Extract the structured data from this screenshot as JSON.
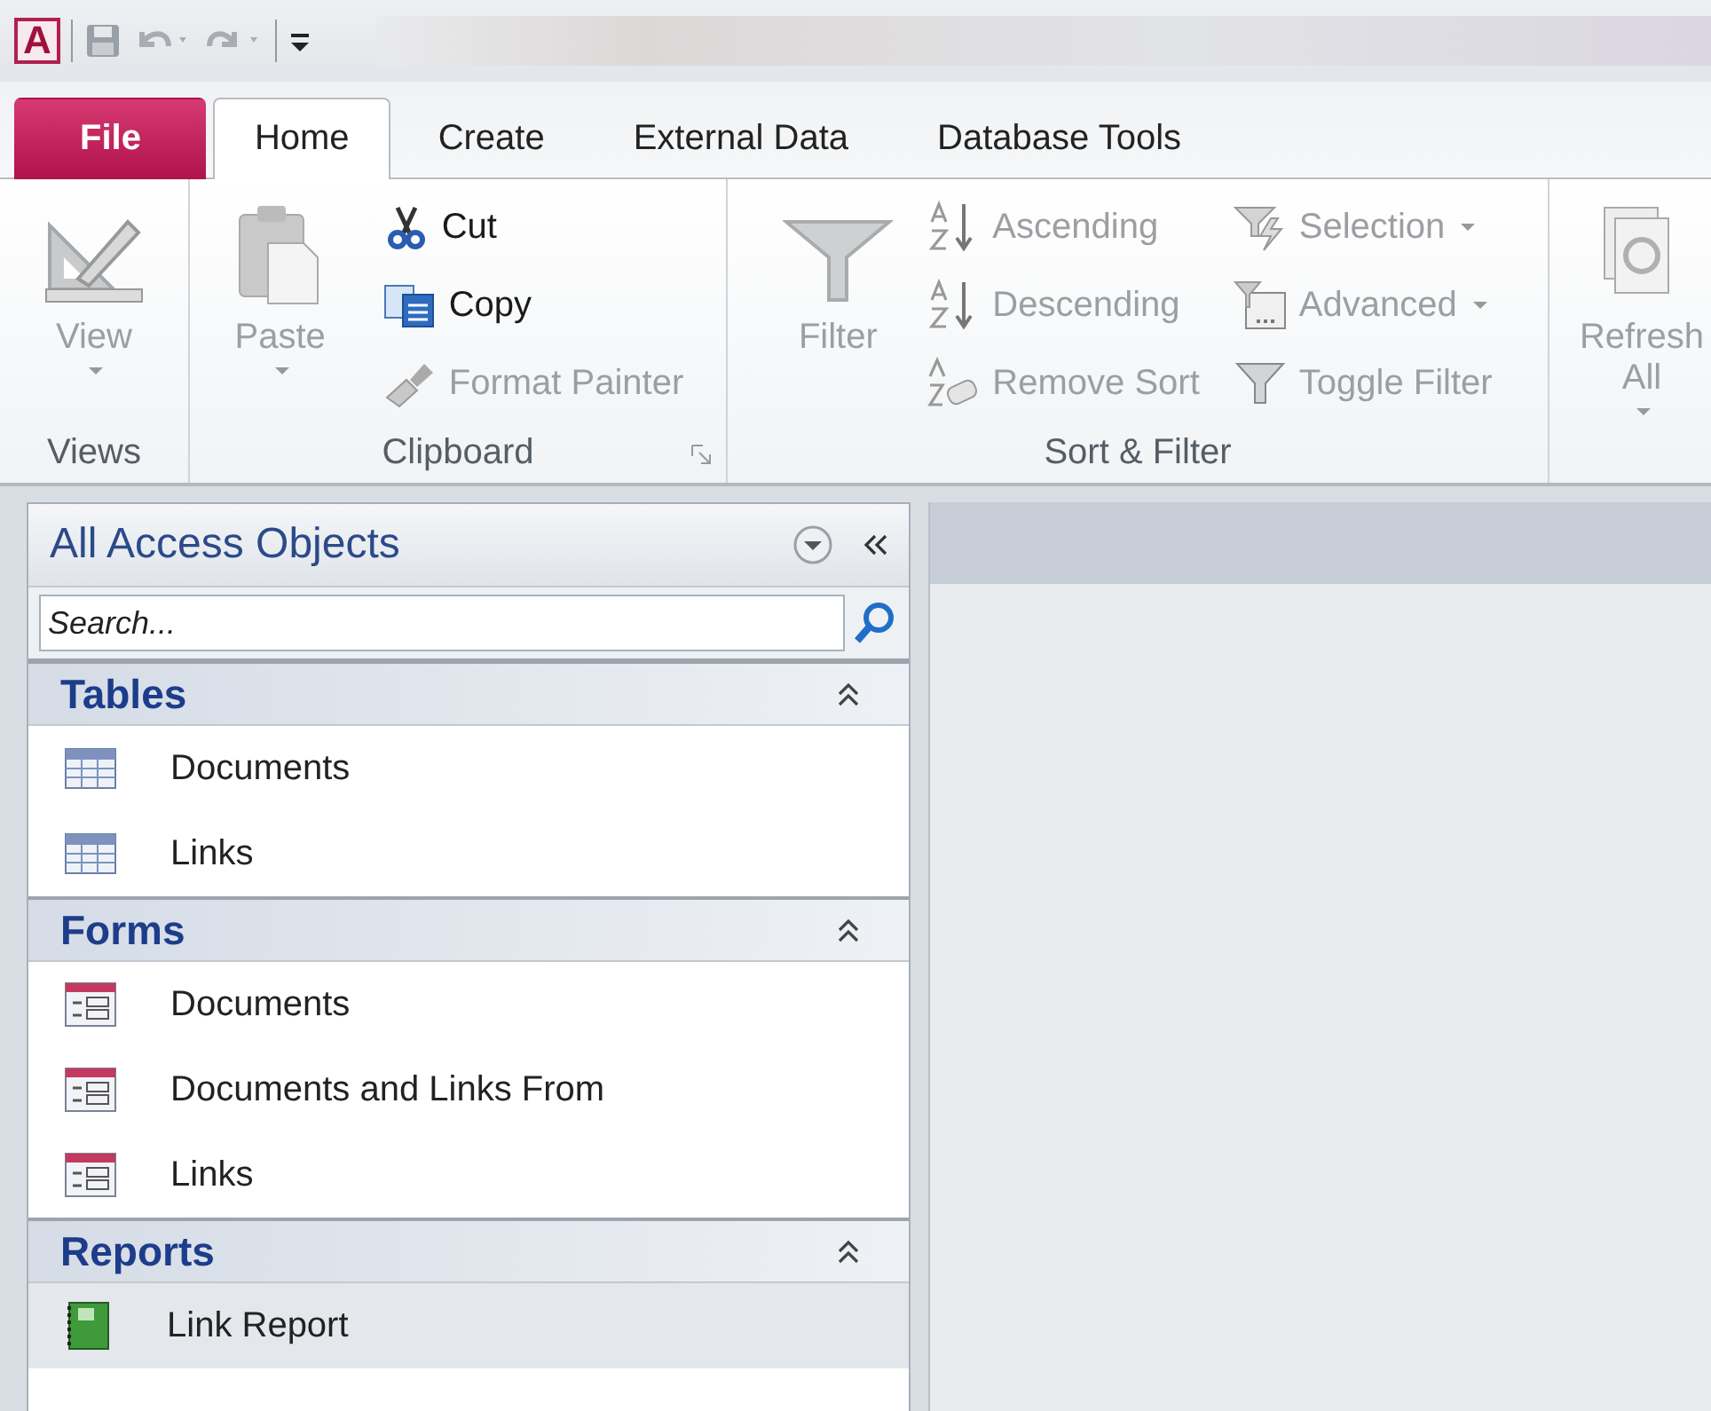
{
  "quick_access": {
    "app_logo": "A"
  },
  "tabs": [
    {
      "label": "File",
      "kind": "file",
      "selected": false
    },
    {
      "label": "Home",
      "kind": "tab",
      "selected": true
    },
    {
      "label": "Create",
      "kind": "tab",
      "selected": false
    },
    {
      "label": "External Data",
      "kind": "tab",
      "selected": false
    },
    {
      "label": "Database Tools",
      "kind": "tab",
      "selected": false
    }
  ],
  "ribbon_groups": [
    {
      "label": "Views",
      "dialog_launcher": false,
      "columns": [
        [
          {
            "label": "View",
            "kind": "large",
            "disabled": true,
            "dropdown": true
          }
        ]
      ]
    },
    {
      "label": "Clipboard",
      "dialog_launcher": true,
      "columns": [
        [
          {
            "label": "Paste",
            "kind": "large",
            "disabled": true,
            "dropdown": true
          }
        ],
        [
          {
            "label": "Cut",
            "kind": "small",
            "disabled": false,
            "dropdown": false
          },
          {
            "label": "Copy",
            "kind": "small",
            "disabled": false,
            "dropdown": false
          },
          {
            "label": "Format Painter",
            "kind": "small",
            "disabled": true,
            "dropdown": false
          }
        ]
      ]
    },
    {
      "label": "Sort & Filter",
      "dialog_launcher": false,
      "columns": [
        [
          {
            "label": "Filter",
            "kind": "large",
            "disabled": true,
            "dropdown": false
          }
        ],
        [
          {
            "label": "Ascending",
            "kind": "small",
            "disabled": true,
            "dropdown": false
          },
          {
            "label": "Descending",
            "kind": "small",
            "disabled": true,
            "dropdown": false
          },
          {
            "label": "Remove Sort",
            "kind": "small",
            "disabled": true,
            "dropdown": false
          }
        ],
        [
          {
            "label": "Selection",
            "kind": "small",
            "disabled": true,
            "dropdown": true
          },
          {
            "label": "Advanced",
            "kind": "small",
            "disabled": true,
            "dropdown": true
          },
          {
            "label": "Toggle Filter",
            "kind": "small",
            "disabled": true,
            "dropdown": false
          }
        ]
      ]
    },
    {
      "columns": [
        [
          {
            "label": "Refresh All",
            "kind": "large",
            "disabled": true,
            "dropdown": true
          }
        ]
      ]
    }
  ],
  "nav_pane": {
    "title": "All Access Objects",
    "search": {
      "placeholder": "Search..."
    },
    "groups": [
      {
        "name": "Tables",
        "expanded": true,
        "items": [
          {
            "label": "Documents",
            "selected": false
          },
          {
            "label": "Links",
            "selected": false
          }
        ]
      },
      {
        "name": "Forms",
        "expanded": true,
        "items": [
          {
            "label": "Documents",
            "selected": false
          },
          {
            "label": "Documents and Links From",
            "selected": false
          },
          {
            "label": "Links",
            "selected": false
          }
        ]
      },
      {
        "name": "Reports",
        "expanded": true,
        "items": [
          {
            "label": "Link Report",
            "selected": true
          }
        ]
      }
    ]
  }
}
